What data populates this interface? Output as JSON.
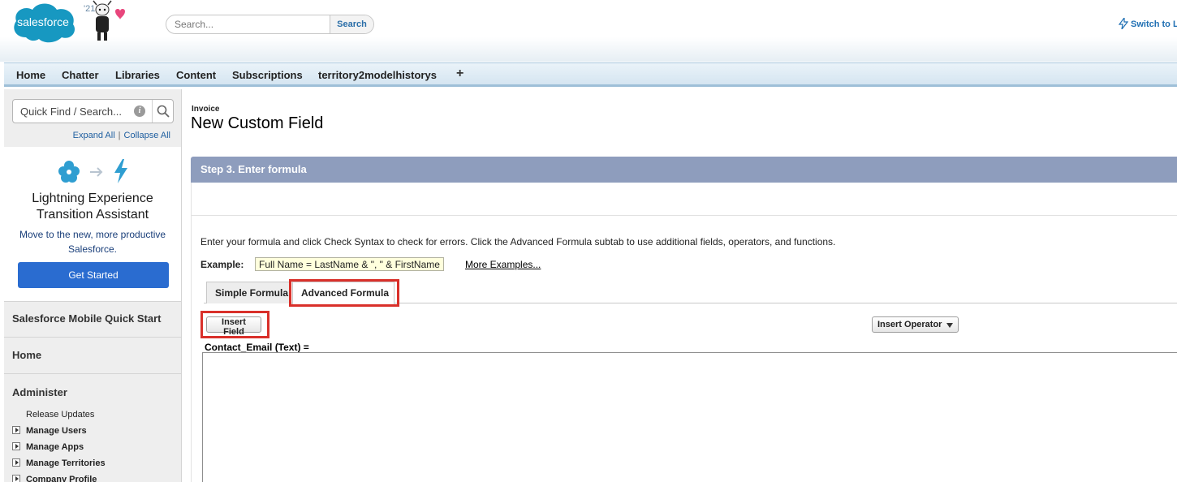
{
  "header": {
    "logo_text": "salesforce",
    "release_badge": "'21",
    "search_placeholder": "Search...",
    "search_button": "Search",
    "switch_link": "Switch to L"
  },
  "nav": {
    "tabs": [
      "Home",
      "Chatter",
      "Libraries",
      "Content",
      "Subscriptions",
      "territory2modelhistorys"
    ],
    "plus": "+"
  },
  "sidebar": {
    "quickfind_placeholder": "Quick Find / Search...",
    "info_glyph": "i",
    "expand_all": "Expand All",
    "separator": "|",
    "collapse_all": "Collapse All",
    "lightning_card": {
      "title_line1": "Lightning Experience",
      "title_line2": "Transition Assistant",
      "desc_line1": "Move to the new, more productive",
      "desc_line2": "Salesforce.",
      "button": "Get Started"
    },
    "sections": {
      "mobile": "Salesforce Mobile Quick Start",
      "home": "Home",
      "administer": "Administer"
    },
    "administer_items": {
      "release_updates": "Release Updates",
      "manage_users": "Manage Users",
      "manage_apps": "Manage Apps",
      "manage_territories": "Manage Territories",
      "company_profile": "Company Profile"
    }
  },
  "main": {
    "object_label": "Invoice",
    "title": "New Custom Field",
    "step_title": "Step 3. Enter formula",
    "instructions": "Enter your formula and click Check Syntax to check for errors. Click the Advanced Formula subtab to use additional fields, operators, and functions.",
    "example_label": "Example:",
    "example_formula": "Full Name = LastName & \", \" & FirstName",
    "more_examples": "More Examples...",
    "tabs": {
      "simple": "Simple Formula",
      "advanced": "Advanced Formula"
    },
    "insert_field": "Insert Field",
    "insert_operator": "Insert Operator",
    "field_label": "Contact_Email (Text) =",
    "formula_value": ""
  },
  "colors": {
    "nav_bg": "#d5e5f1",
    "step_bar": "#8e9dbd",
    "button_blue": "#2a6cd0",
    "highlight": "#d9302a",
    "link": "#1f5fa0"
  }
}
